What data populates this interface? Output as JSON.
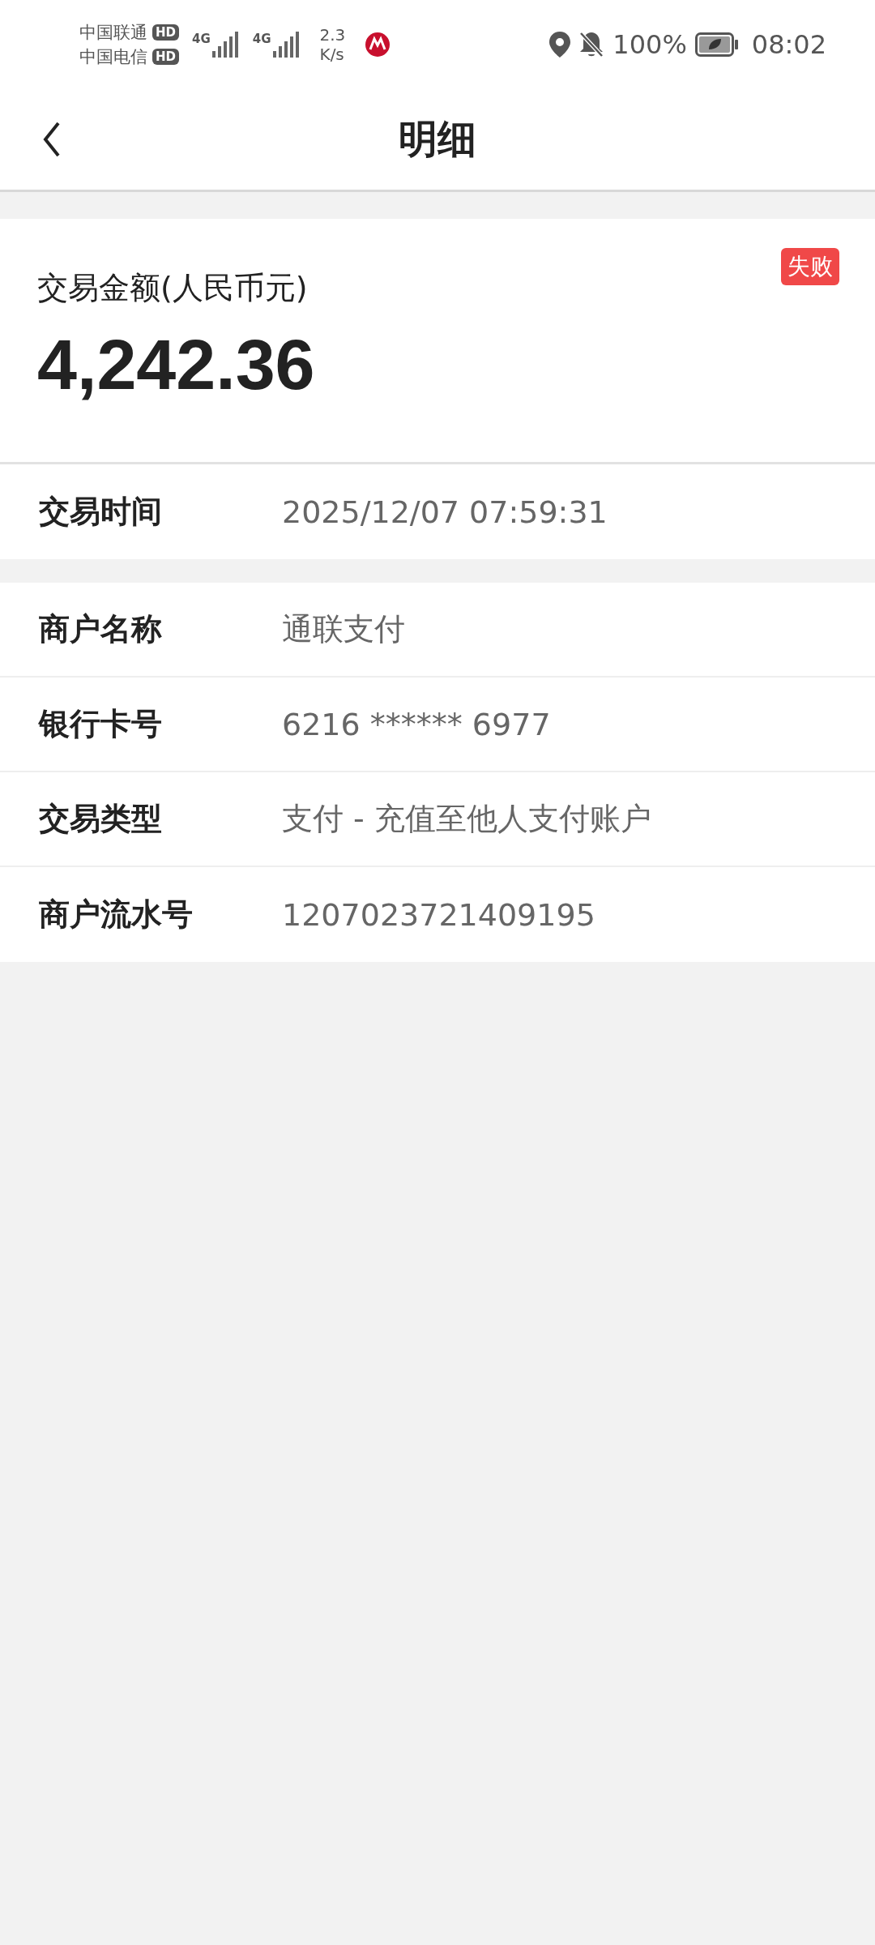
{
  "status_bar": {
    "carriers": [
      {
        "name": "中国联通",
        "tag": "HD"
      },
      {
        "name": "中国电信",
        "tag": "HD"
      }
    ],
    "signals": [
      {
        "label": "4G"
      },
      {
        "label": "4G"
      }
    ],
    "speed": [
      "2.3",
      "K/s"
    ],
    "battery": "100%",
    "time": "08:02"
  },
  "header": {
    "title": "明细"
  },
  "summary": {
    "label": "交易金额(人民币元)",
    "amount": "4,242.36",
    "status": "失败"
  },
  "sections": [
    [
      {
        "label": "交易时间",
        "value": "2025/12/07 07:59:31"
      }
    ],
    [
      {
        "label": "商户名称",
        "value": "通联支付"
      },
      {
        "label": "银行卡号",
        "value": "6216 ****** 6977"
      },
      {
        "label": "交易类型",
        "value": "支付 - 充值至他人支付账户"
      },
      {
        "label": "商户流水号",
        "value": "1207023721409195"
      }
    ]
  ]
}
